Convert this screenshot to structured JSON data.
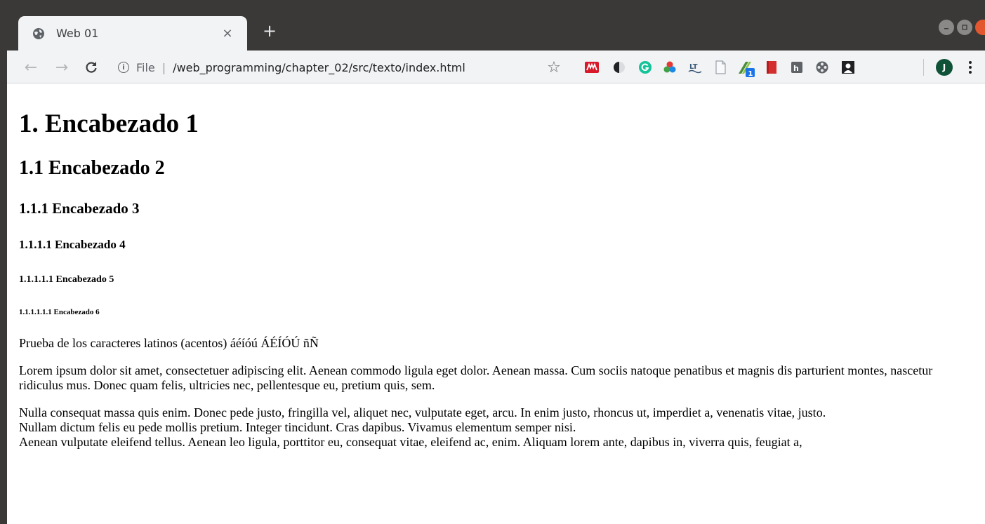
{
  "browser": {
    "tab": {
      "title": "Web 01",
      "favicon": "globe-icon",
      "close_glyph": "×"
    },
    "new_tab_glyph": "+",
    "nav": {
      "back_glyph": "←",
      "forward_glyph": "→",
      "reload_glyph": "C"
    },
    "omnibox": {
      "info_glyph": "i",
      "scheme": "File",
      "separator": "|",
      "url": "/web_programming/chapter_02/src/texto/index.html"
    },
    "bookmark_glyph": "☆",
    "extensions": [
      {
        "name": "mendeley-icon",
        "color": "#d7192a"
      },
      {
        "name": "dark-reader-icon",
        "color": "#202124"
      },
      {
        "name": "grammarly-icon",
        "color": "#15c39a"
      },
      {
        "name": "color-picker-icon",
        "color": "#e74c3c"
      },
      {
        "name": "languagetool-icon",
        "color": "#3b5a7a"
      },
      {
        "name": "document-icon",
        "color": "#9aa0a6"
      },
      {
        "name": "tab-manager-icon",
        "color": "#4c8c3a"
      },
      {
        "name": "bookmark-red-icon",
        "color": "#d32f2f"
      },
      {
        "name": "h-extension-icon",
        "color": "#5f6368"
      },
      {
        "name": "film-reel-icon",
        "color": "#5f6368"
      },
      {
        "name": "portrait-icon",
        "color": "#202124"
      }
    ],
    "extension_badge": "1",
    "profile_initial": "J"
  },
  "page": {
    "h1": "1. Encabezado 1",
    "h2": "1.1 Encabezado 2",
    "h3": "1.1.1 Encabezado 3",
    "h4": "1.1.1.1 Encabezado 4",
    "h5": "1.1.1.1.1 Encabezado 5",
    "h6": "1.1.1.1.1.1 Encabezado 6",
    "accents": "Prueba de los caracteres latinos (acentos) áéíóú ÁÉÍÓÚ ñÑ",
    "lorem": "Lorem ipsum dolor sit amet, consectetuer adipiscing elit. Aenean commodo ligula eget dolor. Aenean massa. Cum sociis natoque penatibus et magnis dis parturient montes, nascetur ridiculus mus. Donec quam felis, ultricies nec, pellentesque eu, pretium quis, sem.",
    "nulla_lines": [
      "Nulla consequat massa quis enim. Donec pede justo, fringilla vel, aliquet nec, vulputate eget, arcu. In enim justo, rhoncus ut, imperdiet a, venenatis vitae, justo.",
      "Nullam dictum felis eu pede mollis pretium. Integer tincidunt. Cras dapibus. Vivamus elementum semper nisi.",
      "Aenean vulputate eleifend tellus. Aenean leo ligula, porttitor eu, consequat vitae, eleifend ac, enim. Aliquam lorem ante, dapibus in, viverra quis, feugiat a,"
    ]
  }
}
